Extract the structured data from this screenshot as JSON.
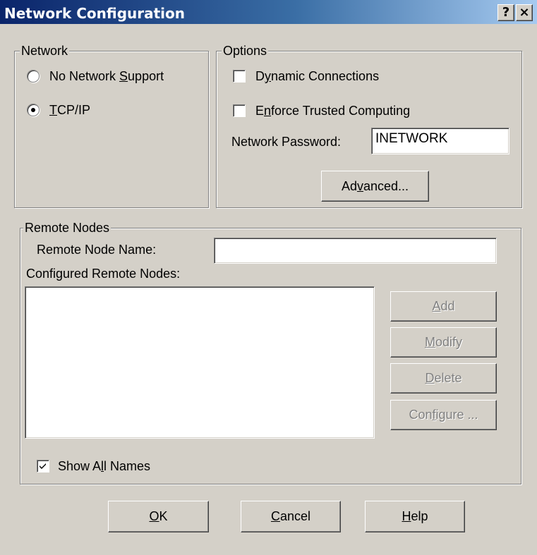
{
  "window": {
    "title": "Network Configuration",
    "help_label": "?",
    "close_label": "×"
  },
  "network_group": {
    "legend": "Network",
    "options": [
      {
        "pre": "No Network ",
        "key": "S",
        "post": "upport",
        "selected": false
      },
      {
        "pre": "",
        "key": "T",
        "post": "CP/IP",
        "selected": true
      }
    ]
  },
  "options_group": {
    "legend": "Options",
    "dynamic_connections": {
      "pre": "D",
      "key": "y",
      "post": "namic Connections",
      "checked": false
    },
    "enforce_trusted": {
      "pre": "E",
      "key": "n",
      "post": "force Trusted Computing",
      "checked": false
    },
    "password_label": "Network Password:",
    "password_value": "INETWORK",
    "advanced_button": {
      "pre": "Ad",
      "key": "v",
      "post": "anced..."
    }
  },
  "remote_group": {
    "legend": "Remote Nodes",
    "node_name_label": "Remote Node Name:",
    "node_name_value": "",
    "configured_label": "Configured Remote Nodes:",
    "configured_items": [],
    "buttons": {
      "add": {
        "pre": "",
        "key": "A",
        "post": "dd",
        "enabled": false
      },
      "modify": {
        "pre": "",
        "key": "M",
        "post": "odify",
        "enabled": false
      },
      "delete": {
        "pre": "",
        "key": "D",
        "post": "elete",
        "enabled": false
      },
      "configure": {
        "pre": "Con",
        "key": "f",
        "post": "igure ...",
        "enabled": false
      }
    },
    "show_all_names": {
      "pre": "Show A",
      "key": "l",
      "post": "l Names",
      "checked": true
    }
  },
  "footer_buttons": {
    "ok": {
      "pre": "",
      "key": "O",
      "post": "K"
    },
    "cancel": {
      "pre": "",
      "key": "C",
      "post": "ancel"
    },
    "help": {
      "pre": "",
      "key": "H",
      "post": "elp"
    }
  }
}
